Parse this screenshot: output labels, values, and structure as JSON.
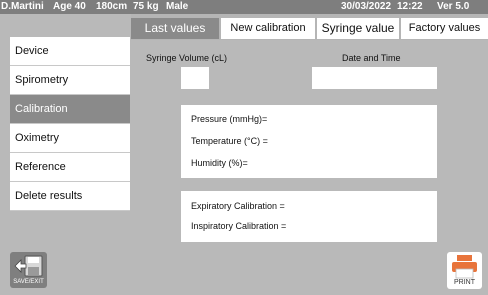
{
  "status_bar": {
    "user": "D.Martini",
    "age": "Age 40",
    "height": "180cm",
    "weight": "75 kg",
    "sex": "Male",
    "date": "30/03/2022",
    "time": "12:22",
    "version": "Ver 5.0"
  },
  "sidebar": {
    "items": [
      {
        "label": "Device"
      },
      {
        "label": "Spirometry"
      },
      {
        "label": "Calibration",
        "active": true
      },
      {
        "label": "Oximetry"
      },
      {
        "label": "Reference"
      },
      {
        "label": "Delete  results"
      }
    ],
    "save_label": "SAVE/EXIT"
  },
  "tabs": [
    {
      "label": "Last values",
      "active": true
    },
    {
      "label": "New calibration"
    },
    {
      "label": "Syringe value"
    },
    {
      "label": "Factory values"
    }
  ],
  "fields": {
    "syringe_volume_label": "Syringe Volume (cL)",
    "syringe_volume_value": "",
    "date_time_label": "Date and Time",
    "date_time_value": ""
  },
  "conditions": {
    "pressure_label": "Pressure (mmHg)=",
    "temperature_label": "Temperature (°C) =",
    "humidity_label": "Humidity (%)="
  },
  "calibration": {
    "expiratory_label": "Expiratory Calibration =",
    "inspiratory_label": "Inspiratory Calibration ="
  },
  "print_label": "PRINT",
  "colors": {
    "accent_orange": "#e8743b",
    "active_gray": "#8a8a8a",
    "background_gray": "#b9b9b9"
  }
}
